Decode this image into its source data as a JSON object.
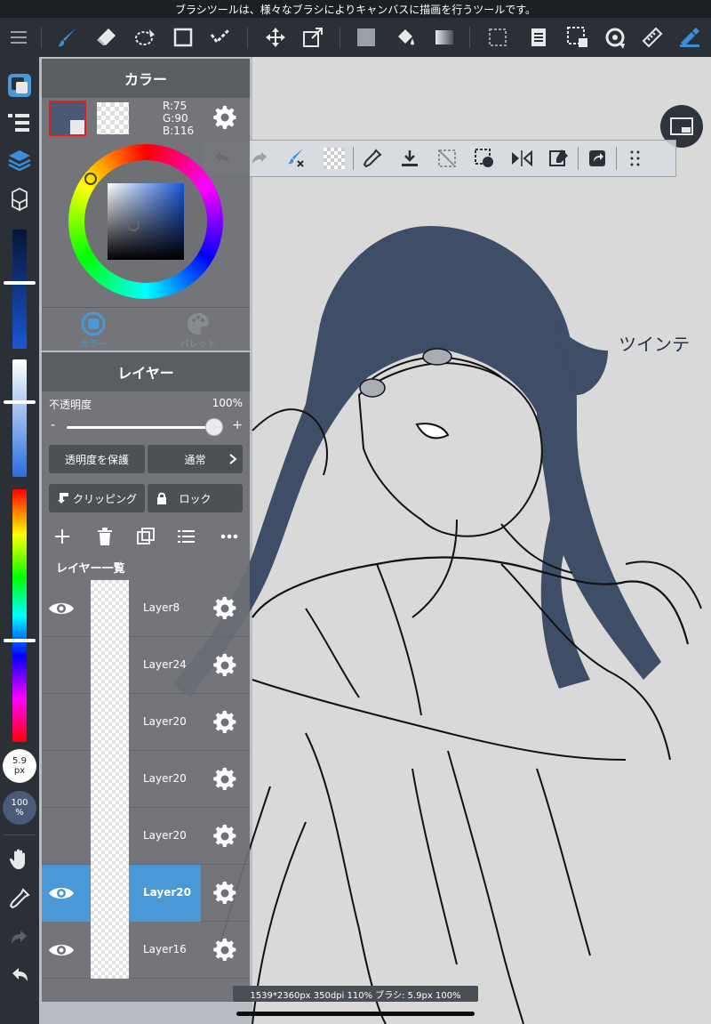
{
  "tooltip": "ブラシツールは、様々なブラシによりキャンバスに描画を行うツールです。",
  "top_toolbar": {
    "tools": [
      "menu-icon",
      "brush-icon",
      "eraser-icon",
      "lasso-select-icon",
      "rectangle-icon",
      "check-select-icon",
      "move-icon",
      "transform-icon",
      "fill-color-icon",
      "bucket-icon",
      "gradient-icon",
      "deselect-icon",
      "layer-copy-icon",
      "select-area-icon",
      "rotate-icon",
      "ruler-icon",
      "brush-settings-icon"
    ]
  },
  "color_panel": {
    "title": "カラー",
    "rgb": {
      "r": "R:75",
      "g": "G:90",
      "b": "B:116"
    },
    "main_color": "#4b5a74",
    "tab_color": "カラー",
    "tab_palette": "パレット"
  },
  "layer_panel": {
    "title": "レイヤー",
    "opacity_label": "不透明度",
    "opacity_value": "100%",
    "opacity_level": 1.0,
    "minus_label": "-",
    "plus_label": "+",
    "protect_alpha": "透明度を保護",
    "blend_mode": "通常",
    "clipping": "クリッピング",
    "lock": "ロック",
    "list_title": "レイヤー一覧",
    "layers": [
      {
        "name": "Layer8",
        "visible": true,
        "selected": false
      },
      {
        "name": "Layer24",
        "visible": false,
        "selected": false
      },
      {
        "name": "Layer20",
        "visible": false,
        "selected": false
      },
      {
        "name": "Layer20",
        "visible": false,
        "selected": false
      },
      {
        "name": "Layer20",
        "visible": false,
        "selected": false
      },
      {
        "name": "Layer20",
        "visible": true,
        "selected": true
      },
      {
        "name": "Layer16",
        "visible": true,
        "selected": false
      }
    ]
  },
  "sidebar": {
    "brush_size": "5.9",
    "brush_size_unit": "px",
    "brush_opacity": "100",
    "brush_opacity_unit": "%"
  },
  "canvas": {
    "annotation": "ツインテ"
  },
  "status_bar": "1539*2360px 350dpi 110% ブラシ: 5.9px 100%",
  "colors": {
    "accent": "#4b98d6",
    "hair": "#3d4e66",
    "panel": "#6e7074",
    "toolbar": "#2b2f36"
  }
}
